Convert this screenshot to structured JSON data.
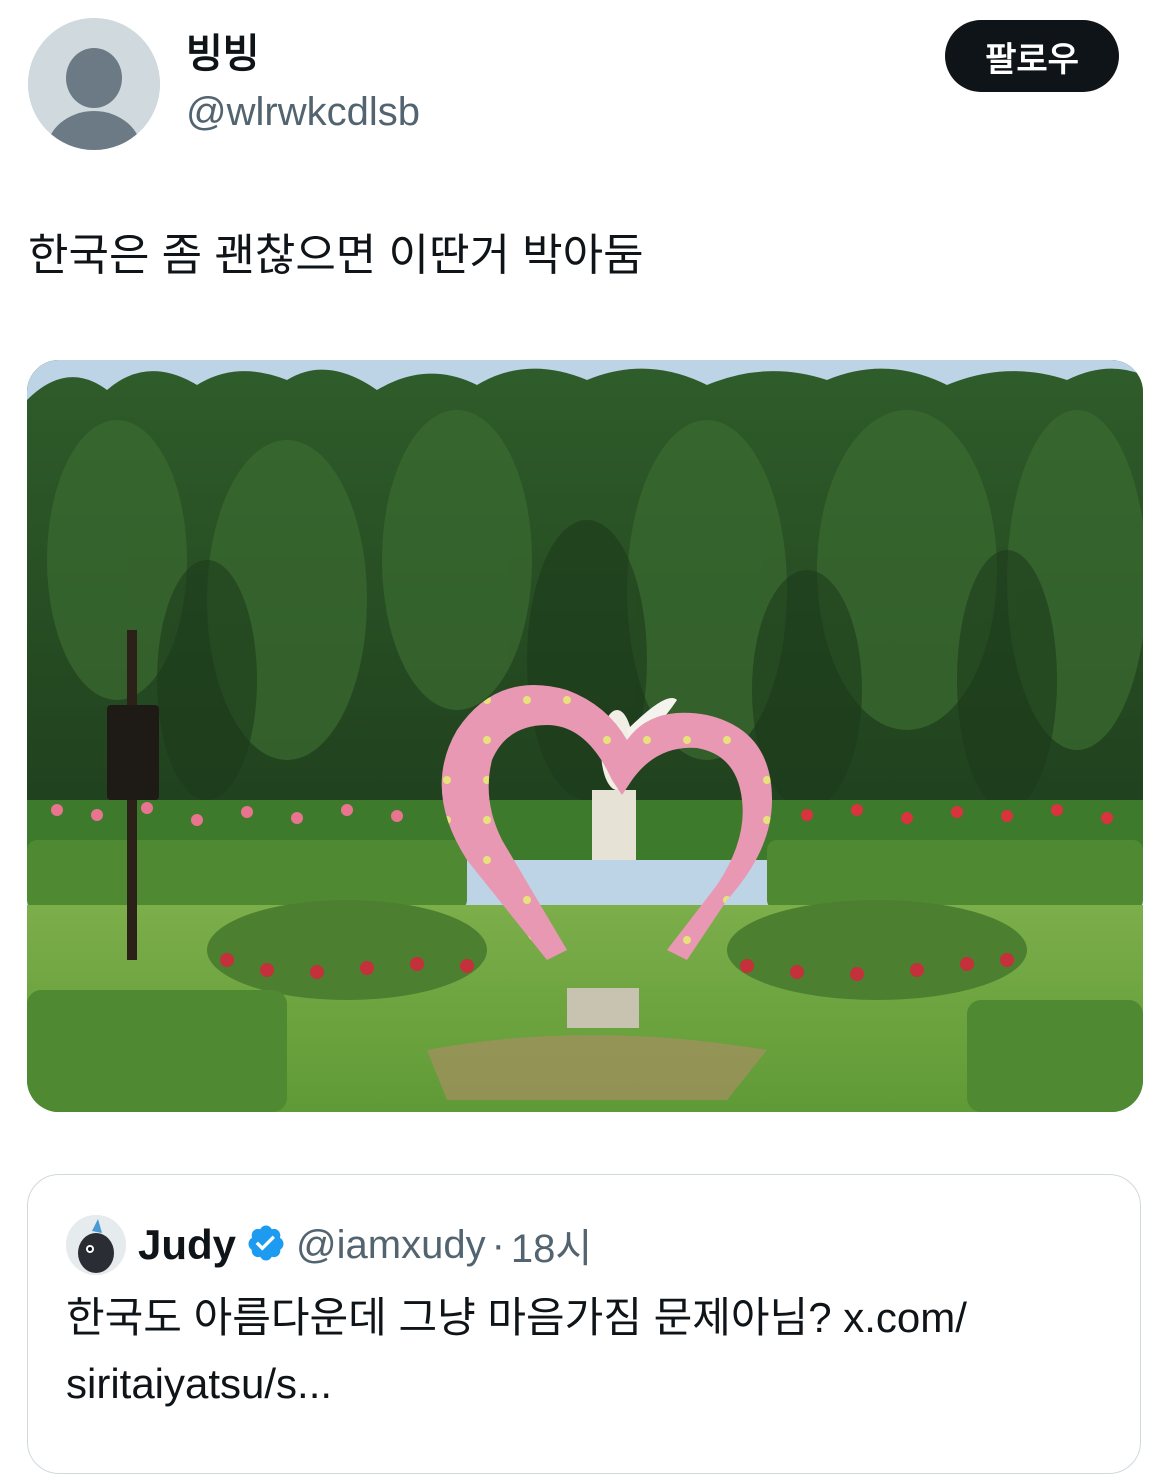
{
  "author": {
    "display_name": "빙빙",
    "handle": "@wlrwkcdlsb",
    "avatar_icon": "default-avatar-icon"
  },
  "follow_button": {
    "label": "팔로우"
  },
  "tweet": {
    "text": "한국은 좀 괜찮으면 이딴거 박아둠"
  },
  "media": {
    "icon": "garden-photo-heart-arch"
  },
  "quote": {
    "name": "Judy",
    "handle": "@iamxudy",
    "separator": "·",
    "time": "18시",
    "text": "한국도 아름다운데 그냥 마음가짐 문제아님? ",
    "link_text": "x.com/\nsiritaiyatsu/s..."
  },
  "colors": {
    "primary_text": "#0f1419",
    "secondary_text": "#536471",
    "verified_blue": "#1d9bf0",
    "border": "#cfd9de"
  }
}
